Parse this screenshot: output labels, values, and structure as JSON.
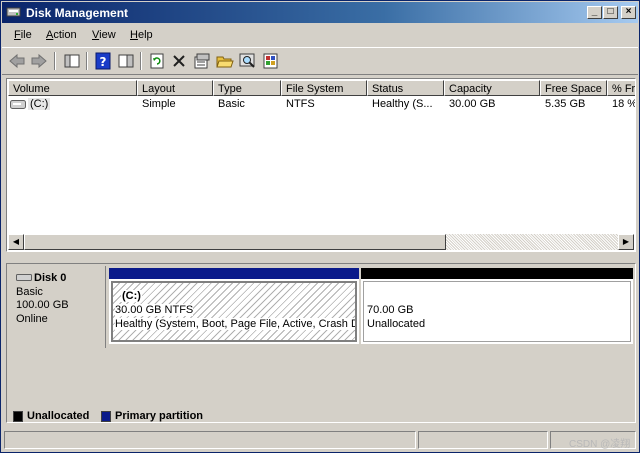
{
  "window": {
    "title": "Disk Management"
  },
  "titlebar": {
    "minimize": "_",
    "maximize": "□",
    "close": "×"
  },
  "menu": [
    {
      "accel": "F",
      "rest": "ile"
    },
    {
      "accel": "A",
      "rest": "ction"
    },
    {
      "accel": "V",
      "rest": "iew"
    },
    {
      "accel": "H",
      "rest": "elp"
    }
  ],
  "toolbar": {
    "icons": [
      "back-arrow-icon",
      "forward-arrow-icon",
      "console-tree-icon",
      "help-icon",
      "properties-panel-icon",
      "refresh-icon",
      "delete-icon",
      "properties-icon",
      "open-folder-icon",
      "search-icon",
      "export-icon"
    ]
  },
  "list": {
    "columns": [
      "Volume",
      "Layout",
      "Type",
      "File System",
      "Status",
      "Capacity",
      "Free Space",
      "% Fr"
    ],
    "rows": [
      {
        "volume": "(C:)",
        "layout": "Simple",
        "type": "Basic",
        "filesystem": "NTFS",
        "status": "Healthy (S...",
        "capacity": "30.00 GB",
        "free": "5.35 GB",
        "pct": "18 %"
      }
    ]
  },
  "disk": {
    "name": "Disk 0",
    "type": "Basic",
    "size": "100.00 GB",
    "state": "Online",
    "partitions": [
      {
        "label": "(C:)",
        "size_fs": "30.00 GB NTFS",
        "status": "Healthy (System, Boot, Page File, Active, Crash Dump, Primary Partition)"
      },
      {
        "size": "70.00 GB",
        "status": "Unallocated"
      }
    ]
  },
  "legend": [
    {
      "label": "Unallocated",
      "color": "#000000"
    },
    {
      "label": "Primary partition",
      "color": "#0a1a8a"
    }
  ],
  "watermark": "CSDN @凌翔"
}
